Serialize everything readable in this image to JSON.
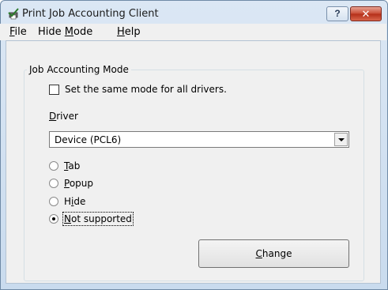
{
  "window": {
    "title": "Print Job Accounting Client",
    "help_label": "?",
    "close_label": "✕"
  },
  "menu": {
    "items": [
      {
        "label": "File",
        "accel_index": 0
      },
      {
        "label": "Hide Mode",
        "accel_index": 5
      },
      {
        "label": "Help",
        "accel_index": 0
      }
    ]
  },
  "group": {
    "title": "Job Accounting Mode",
    "same_mode": {
      "label": "Set the same mode for all drivers.",
      "checked": false
    },
    "driver_label": "Driver",
    "driver_value": "Device (PCL6)",
    "options": [
      {
        "label": "Tab",
        "checked": false
      },
      {
        "label": "Popup",
        "checked": false
      },
      {
        "label": "Hide",
        "checked": false
      },
      {
        "label": "Not supported",
        "checked": true
      }
    ],
    "change_button": "Change"
  },
  "colors": {
    "titlebar": "#c9dbee",
    "close_button": "#c84a33",
    "dialog_bg": "#f0f0f0"
  }
}
